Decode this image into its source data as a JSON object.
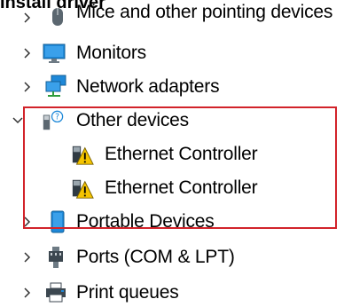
{
  "header": {
    "title": "Install driver"
  },
  "tree": {
    "items": [
      {
        "label": "Mice and other pointing devices",
        "expanded": false,
        "icon": "mouse-icon"
      },
      {
        "label": "Monitors",
        "expanded": false,
        "icon": "monitor-icon"
      },
      {
        "label": "Network adapters",
        "expanded": false,
        "icon": "network-adapter-icon"
      },
      {
        "label": "Other devices",
        "expanded": true,
        "icon": "unknown-device-icon",
        "children": [
          {
            "label": "Ethernet Controller",
            "icon": "warning-device-icon"
          },
          {
            "label": "Ethernet Controller",
            "icon": "warning-device-icon"
          }
        ]
      },
      {
        "label": "Portable Devices",
        "expanded": false,
        "icon": "portable-device-icon"
      },
      {
        "label": "Ports (COM & LPT)",
        "expanded": false,
        "icon": "port-icon"
      },
      {
        "label": "Print queues",
        "expanded": false,
        "icon": "printer-icon"
      }
    ]
  },
  "colors": {
    "highlight": "#d2232a",
    "accent_blue": "#1e88d8"
  }
}
